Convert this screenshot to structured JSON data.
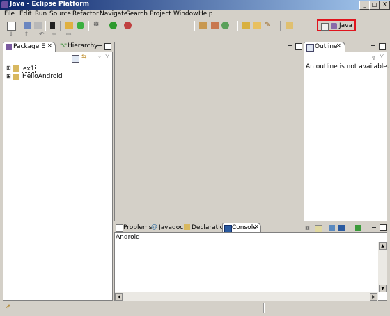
{
  "window": {
    "title": "Java - Eclipse Platform",
    "controls": [
      "_",
      "□",
      "X"
    ]
  },
  "menu": [
    "File",
    "Edit",
    "Run",
    "Source",
    "Refactor",
    "Navigate",
    "Search",
    "Project",
    "Window",
    "Help"
  ],
  "perspective": {
    "label": "Java"
  },
  "package_explorer": {
    "tabs": [
      "Package E",
      "Hierarchy"
    ],
    "tree": [
      {
        "label": "ex1",
        "expander": "⊞"
      },
      {
        "label": "HelloAndroid",
        "expander": "⊞"
      }
    ]
  },
  "outline": {
    "tab": "Outline",
    "message": "An outline is not available."
  },
  "bottom_panel": {
    "tabs": [
      "Problems",
      "Javadoc",
      "Declaration",
      "Console"
    ],
    "console_title": "Android"
  },
  "colors": {
    "titlebar_start": "#0a246a",
    "titlebar_end": "#a6caf0",
    "highlight_border": "#e0141e"
  }
}
